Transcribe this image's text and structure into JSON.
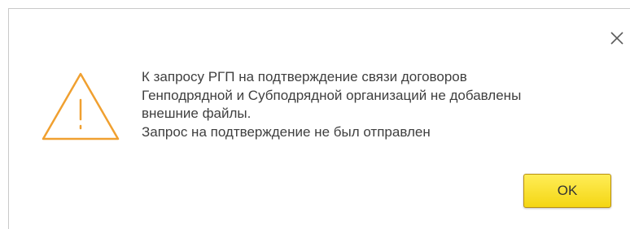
{
  "dialog": {
    "message_lines": [
      "К запросу РГП на подтверждение связи договоров",
      "Генподрядной и Субподрядной организаций не добавлены",
      "внешние файлы.",
      "Запрос на подтверждение не был отправлен"
    ],
    "ok_label": "OK",
    "icons": {
      "warning": "warning-triangle-icon",
      "close": "close-icon"
    },
    "colors": {
      "warning": "#f0a030",
      "ok_button": "#f7dc24"
    }
  }
}
